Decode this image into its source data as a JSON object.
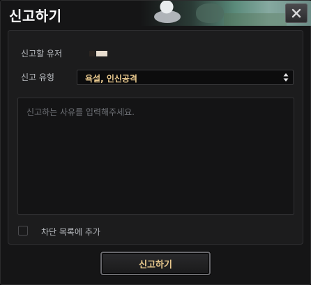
{
  "dialog": {
    "title": "신고하기",
    "close_icon": "close-icon"
  },
  "form": {
    "user_label": "신고할 유저",
    "type_label": "신고 유형",
    "type_selected": "욕설, 인신공격",
    "reason_placeholder": "신고하는 사유를 입력해주세요.",
    "block_label": "차단 목록에 추가",
    "block_checked": false
  },
  "actions": {
    "submit_label": "신고하기"
  },
  "colors": {
    "accent_text": "#e9c98e",
    "background": "#151516",
    "panel": "#1c1c1d"
  }
}
